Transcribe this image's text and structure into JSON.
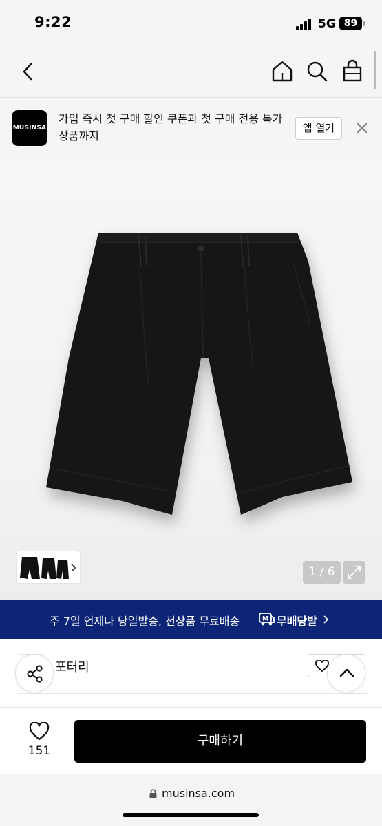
{
  "status_bar": {
    "time": "9:22",
    "network": "5G",
    "battery": "89"
  },
  "nav": {
    "back_icon": "chevron-left-icon",
    "home_icon": "home-icon",
    "search_icon": "search-icon",
    "cart_icon": "shopping-bag-icon"
  },
  "app_banner": {
    "logo_text": "MUSINSA",
    "message": "가입 즉시 첫 구매 할인 쿠폰과 첫 구매 전용 특가 상품까지",
    "open_label": "앱 열기",
    "close_icon": "close-icon"
  },
  "gallery": {
    "counter": "1 / 6",
    "expand_icon": "expand-icon"
  },
  "promo": {
    "text": "주 7일 언제나 당일발송, 전상품 무료배송",
    "badge_text": "M",
    "brand": "무배당발"
  },
  "brand": {
    "name": "포터리"
  },
  "bottom": {
    "like_count": "151",
    "buy_label": "구매하기"
  },
  "browser": {
    "url": "musinsa.com"
  },
  "colors": {
    "promo_bg": "#0c2577",
    "buy_bg": "#000000",
    "banner_bg": "#f5f5f5"
  }
}
